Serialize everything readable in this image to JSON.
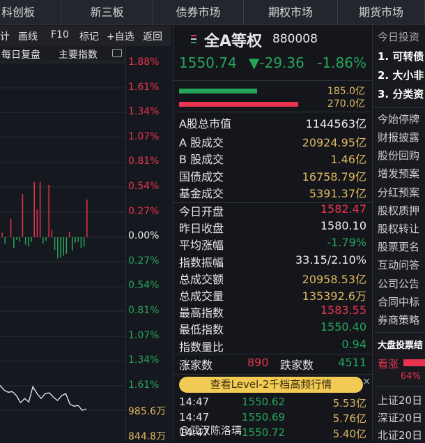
{
  "tabs": [
    "科创板",
    "新三板",
    "债券市场",
    "期权市场",
    "期货市场"
  ],
  "toolbar": {
    "stats": "计",
    "draw": "画线",
    "f10": "F10",
    "mark": "标记",
    "add_watch": "+自选",
    "back": "返回"
  },
  "subbar": {
    "daily_review": "每日复盘",
    "main_index": "主要指数"
  },
  "axis": {
    "pct": [
      "1.88%",
      "1.61%",
      "1.34%",
      "1.07%",
      "0.81%",
      "0.54%",
      "0.27%",
      "0.00%",
      "0.27%",
      "0.54%",
      "0.81%",
      "1.07%",
      "1.34%",
      "1.61%"
    ],
    "vol": [
      "985.6万",
      "844.8万"
    ]
  },
  "index": {
    "name": "全A等权",
    "code": "880008",
    "price": "1550.74",
    "change": "▼-29.36",
    "pct": "-1.86%",
    "flow_out": "185.0亿",
    "flow_in": "270.0亿",
    "flow_out_frac": 0.62,
    "flow_in_frac": 0.95
  },
  "stats1": [
    {
      "label": "A股总市值",
      "value": "1144563亿",
      "color": "white"
    }
  ],
  "stats2": [
    {
      "label": "A 股成交",
      "value": "20924.95亿",
      "color": "gold"
    },
    {
      "label": "B 股成交",
      "value": "1.46亿",
      "color": "gold"
    },
    {
      "label": "国债成交",
      "value": "16758.79亿",
      "color": "gold"
    },
    {
      "label": "基金成交",
      "value": "5391.37亿",
      "color": "gold"
    }
  ],
  "stats3": [
    {
      "label": "今日开盘",
      "value": "1582.47",
      "color": "red"
    },
    {
      "label": "昨日收盘",
      "value": "1580.10",
      "color": "white"
    },
    {
      "label": "平均涨幅",
      "value": "-1.79%",
      "color": "green"
    },
    {
      "label": "指数振幅",
      "value": "33.15/2.10%",
      "color": "white"
    },
    {
      "label": "总成交额",
      "value": "20958.53亿",
      "color": "gold"
    },
    {
      "label": "总成交量",
      "value": "135392.6万",
      "color": "gold"
    },
    {
      "label": "最高指数",
      "value": "1583.55",
      "color": "red"
    },
    {
      "label": "最低指数",
      "value": "1550.40",
      "color": "green"
    },
    {
      "label": "指数量比",
      "value": "0.94",
      "color": "green"
    }
  ],
  "breadth": {
    "up_label": "涨家数",
    "up": "890",
    "down_label": "跌家数",
    "down": "4511"
  },
  "banner": "查看Level-2千档高频行情",
  "ticks": [
    {
      "time": "14:47",
      "price": "1550.62",
      "amount": "5.53亿"
    },
    {
      "time": "14:47",
      "price": "1550.69",
      "amount": "5.76亿"
    },
    {
      "time": "14:47",
      "price": "1550.72",
      "amount": "5.40亿"
    }
  ],
  "watermark": "@武汉陈洛璃",
  "right": {
    "head": "今日投资",
    "items": [
      "1. 可转债",
      "2. 大小非",
      "3. 分类资"
    ],
    "menu": [
      "今始停牌",
      "财报披露",
      "股份回购",
      "增发预案",
      "分红预案",
      "股权质押",
      "股权转让",
      "股票更名",
      "互动问答",
      "公司公告",
      "合同中标",
      "券商策略"
    ],
    "vote_title": "大盘投票结",
    "bull": "看涨",
    "bull_pct": "64%",
    "bull_frac": 0.64,
    "bottom": [
      "上证20日",
      "深证20日",
      "北证20日"
    ]
  },
  "chart_data": {
    "type": "bar",
    "title": "",
    "bars_pct": [
      0.05,
      -0.07,
      0,
      0.2,
      -0.12,
      -0.03,
      -0.05,
      0.47,
      -0.08,
      -0.1,
      -0.05,
      0.6,
      0.3,
      0.6,
      -0.07,
      -0.04,
      0.57,
      0.08,
      -0.14,
      -0.23,
      -0.22,
      -0.2,
      -0.18,
      0.06,
      -0.15,
      -0.06,
      -0.05,
      -0.12,
      -0.1,
      0.41
    ],
    "volume_line_wan": [
      1125,
      1098,
      1086,
      1090,
      1067,
      1028,
      1051,
      1032,
      1118,
      1079,
      1051,
      1079,
      1083,
      1059,
      1040,
      1067,
      1079,
      1020,
      1008,
      1012,
      985,
      993
    ]
  }
}
